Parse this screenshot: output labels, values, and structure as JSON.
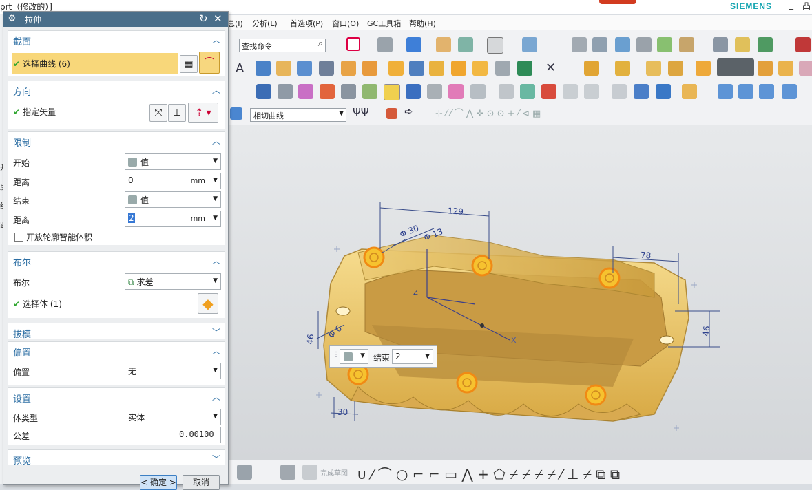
{
  "window": {
    "title": "prt（修改的）]",
    "brand": "SIEMENS",
    "controls": [
      "_",
      "凸"
    ]
  },
  "menu": {
    "items": [
      "息(I)",
      "分析(L)",
      "首选项(P)",
      "窗口(O)",
      "GC工具箱",
      "帮助(H)"
    ]
  },
  "toolbar": {
    "command_search_placeholder": "查找命令",
    "curve_rule": "相切曲线"
  },
  "left_strip": [
    "开",
    "度",
    "结",
    "距"
  ],
  "dialog": {
    "title": "拉伸",
    "sections": {
      "section": {
        "header": "截面",
        "select_curve": "选择曲线 (6)"
      },
      "direction": {
        "header": "方向",
        "specify_vector": "指定矢量"
      },
      "limits": {
        "header": "限制",
        "start_label": "开始",
        "start_value": "值",
        "start_distance_label": "距离",
        "start_distance": "0",
        "start_unit": "mm",
        "end_label": "结束",
        "end_value": "值",
        "end_distance_label": "距离",
        "end_distance": "2",
        "end_unit": "mm",
        "open_profile": "开放轮廓智能体积"
      },
      "boolean": {
        "header": "布尔",
        "boolean_label": "布尔",
        "boolean_value": "求差",
        "select_body": "选择体 (1)"
      },
      "draft": {
        "header": "拔模"
      },
      "offset": {
        "header": "偏置",
        "offset_label": "偏置",
        "offset_value": "无"
      },
      "settings": {
        "header": "设置",
        "body_type_label": "体类型",
        "body_type_value": "实体",
        "tolerance_label": "公差",
        "tolerance_value": "0.00100"
      },
      "preview": {
        "header": "预览"
      }
    },
    "buttons": {
      "ok": "< 确定 >",
      "cancel": "取消"
    }
  },
  "viewport": {
    "dimensions": {
      "d1": "129",
      "d2": "Φ 30",
      "d3": "Φ 13",
      "d4": "78",
      "d5": "46",
      "d6": "46",
      "d7": "30",
      "d8": "Φ 6"
    },
    "axis_labels": {
      "z": "Z",
      "x": "X"
    },
    "minibar": {
      "label": "结束",
      "value": "2"
    }
  },
  "bottom_toolbar": {
    "sketch_done": "完成草图"
  },
  "colors": {
    "dialog_header": "#4a6e8a",
    "section_header_text": "#2c6ea3",
    "selected_row": "#f8d77a",
    "model_body": "#e8c36a",
    "brand": "#12a4b0"
  }
}
